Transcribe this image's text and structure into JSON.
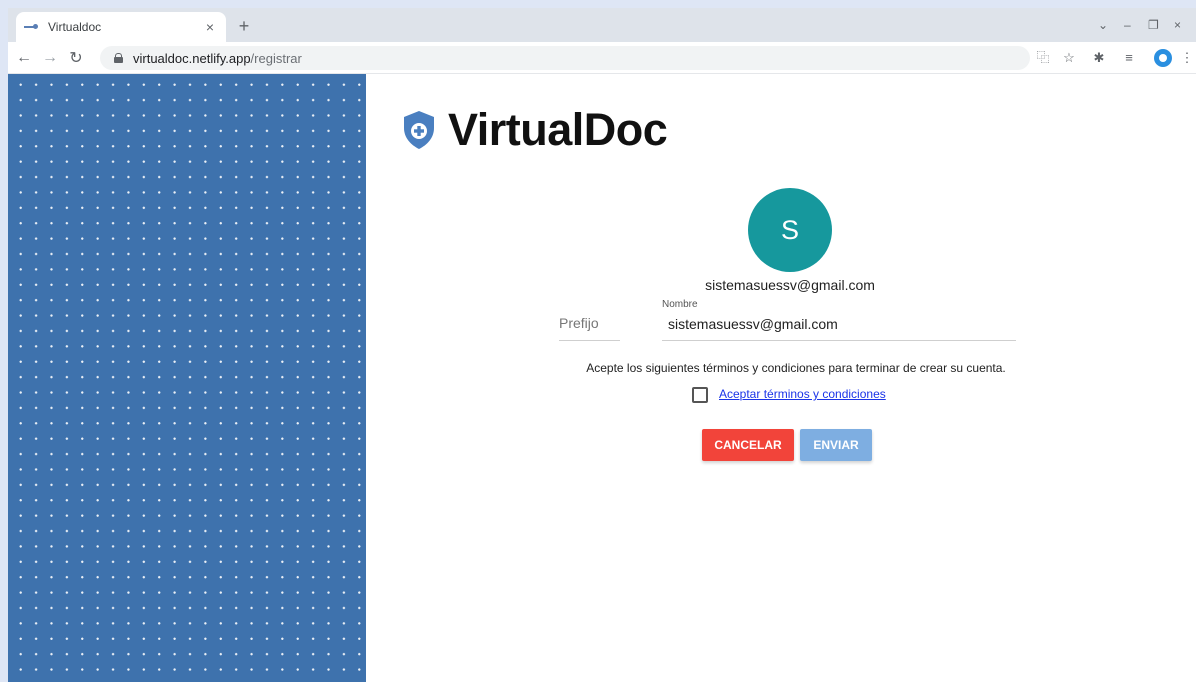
{
  "browser": {
    "tab_title": "Virtualdoc",
    "tab_close": "×",
    "new_tab": "+",
    "url_host": "virtualdoc.netlify.app",
    "url_path": "/registrar",
    "controls": {
      "dropdown": "⌄",
      "minimize": "–",
      "restore": "❐",
      "close": "×"
    },
    "toolbar_icons": {
      "translate": "⿻",
      "bookmark": "☆",
      "extensions": "✱",
      "reading_list": "≡",
      "menu": "⋮"
    }
  },
  "nav": {
    "back": "←",
    "forward": "→",
    "reload": "↻"
  },
  "page": {
    "logo_text": "VirtualDoc",
    "avatar_letter": "S",
    "user_email": "sistemasuessv@gmail.com",
    "form": {
      "prefix_placeholder": "Prefijo",
      "name_label": "Nombre",
      "name_value": "sistemasuessv@gmail.com"
    },
    "terms_text": "Acepte los siguientes términos y condiciones para terminar de crear su cuenta.",
    "terms_link": "Aceptar términos y condiciones",
    "cancel_label": "CANCELAR",
    "send_label": "ENVIAR"
  },
  "colors": {
    "side_panel": "#3e72ad",
    "avatar": "#16989d",
    "cancel": "#f2443a",
    "send": "#7eaee1",
    "shield": "#4a7fc0"
  }
}
